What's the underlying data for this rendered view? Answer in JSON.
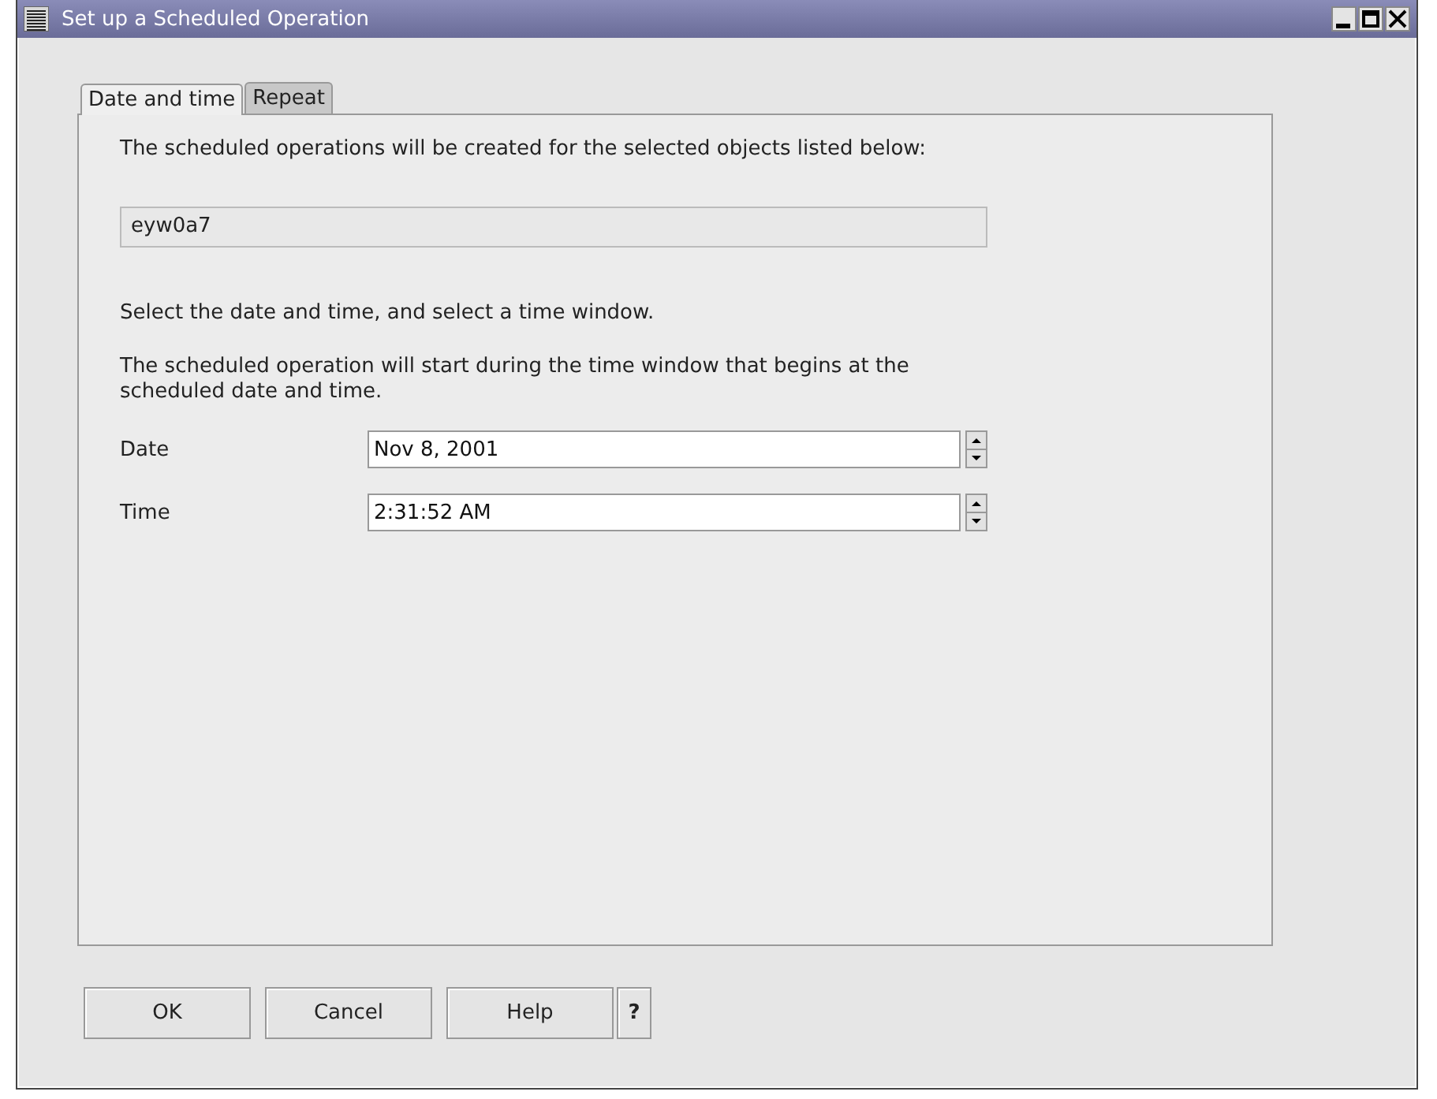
{
  "window": {
    "title": "Set up a Scheduled Operation"
  },
  "tabs": [
    {
      "label": "Date and time",
      "selected": true
    },
    {
      "label": "Repeat",
      "selected": false
    }
  ],
  "intro": "The scheduled operations will be created for the selected objects listed below:",
  "objects_field": {
    "value": "eyw0a7"
  },
  "instruction": "Select the date and time, and select a time window.",
  "note": "The scheduled operation will start during the time window that begins at the scheduled date and time.",
  "fields": [
    {
      "label": "Date",
      "value": "Nov 8, 2001"
    },
    {
      "label": "Time",
      "value": "2:31:52 AM"
    }
  ],
  "buttons": [
    {
      "label": "OK"
    },
    {
      "label": "Cancel"
    },
    {
      "label": "Help"
    },
    {
      "label": "?"
    }
  ]
}
